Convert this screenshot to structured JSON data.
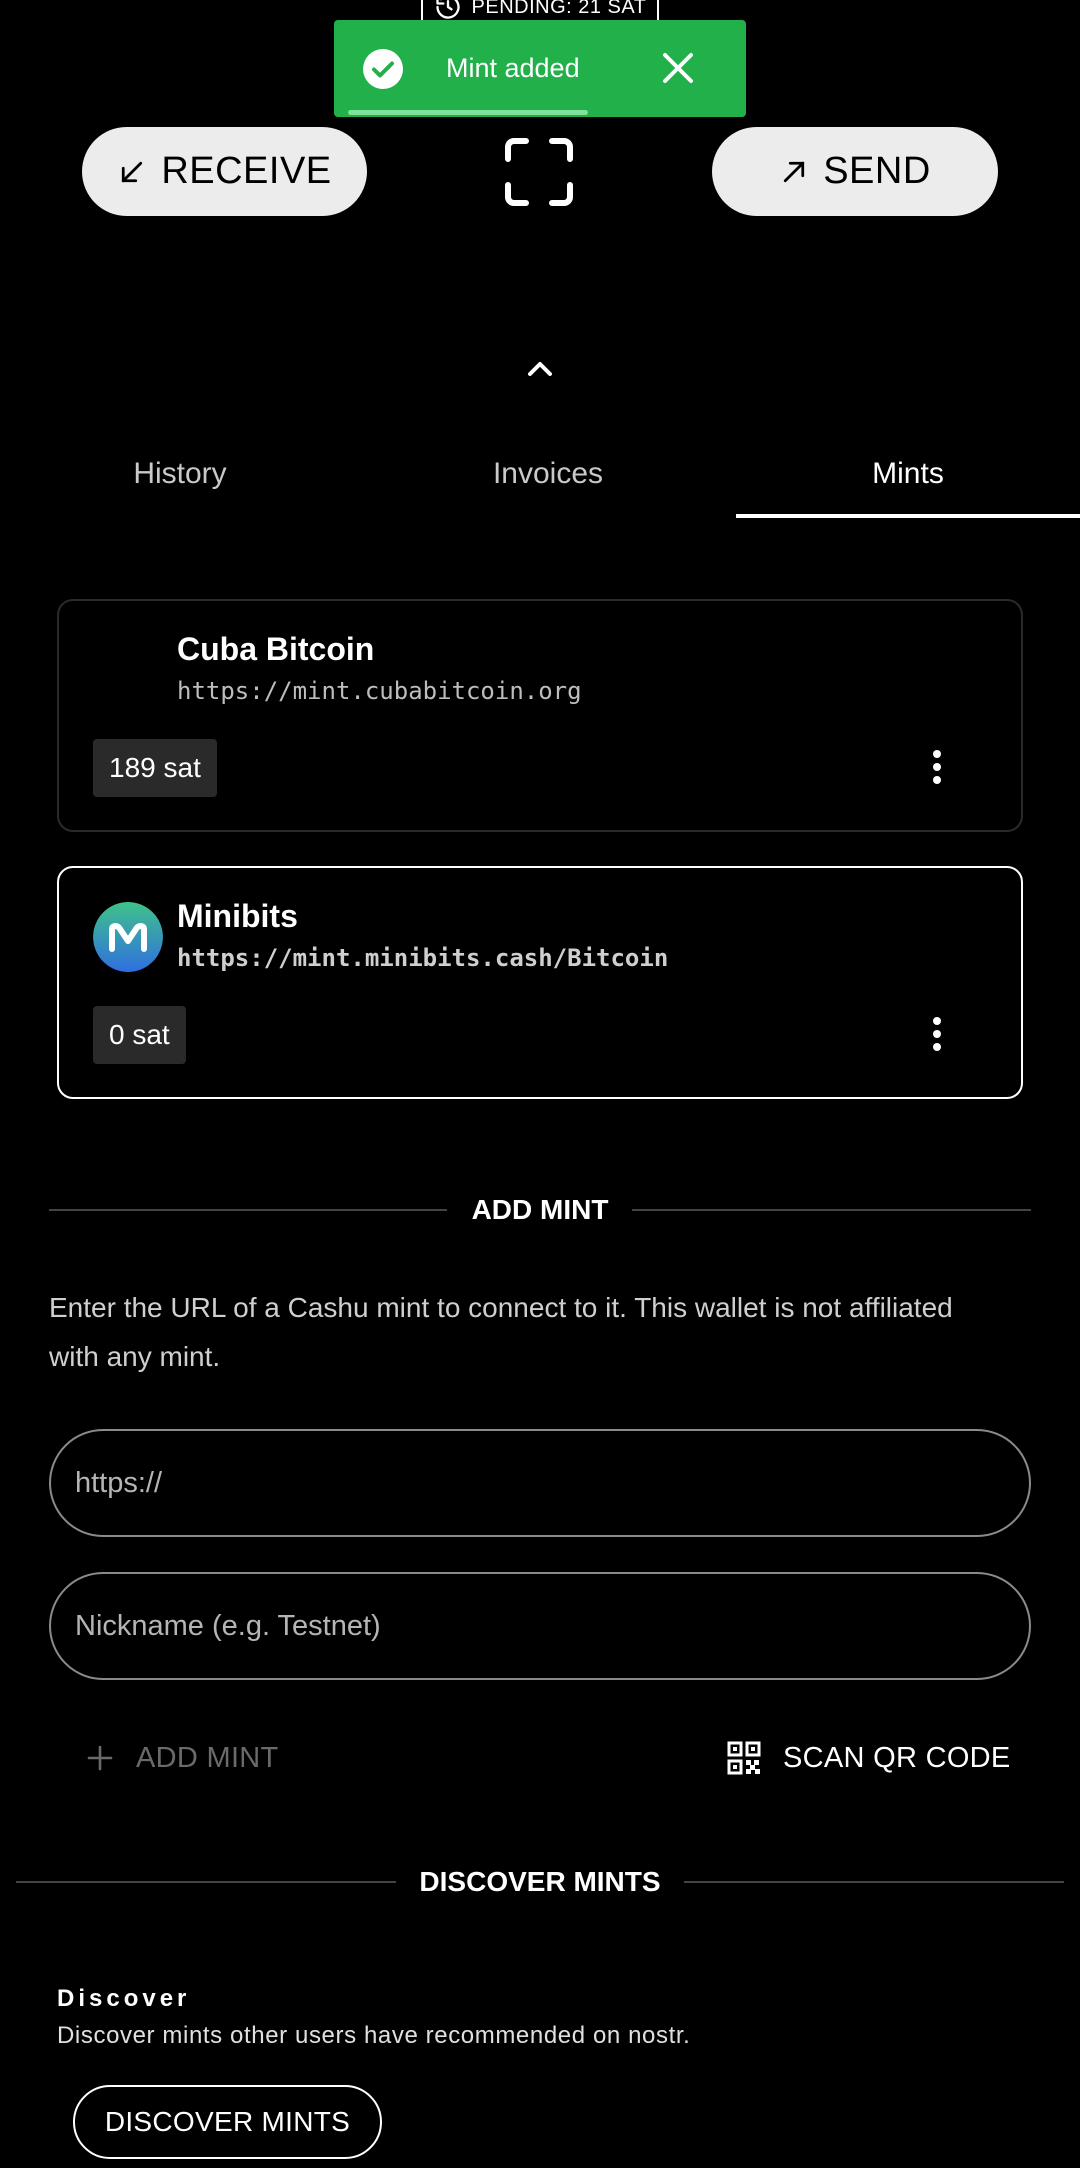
{
  "pending": {
    "label": "PENDING: 21 SAT",
    "icon": "history-icon"
  },
  "toast": {
    "message": "Mint added",
    "color": "#22b04a"
  },
  "actions": {
    "receive": "RECEIVE",
    "send": "SEND"
  },
  "tabs": [
    {
      "label": "History"
    },
    {
      "label": "Invoices"
    },
    {
      "label": "Mints",
      "active": true
    }
  ],
  "mints": [
    {
      "name": "Cuba Bitcoin",
      "url": "https://mint.cubabitcoin.org",
      "balance": "189 sat",
      "selected": false
    },
    {
      "name": "Minibits",
      "url": "https://mint.minibits.cash/Bitcoin",
      "balance": "0 sat",
      "selected": true,
      "avatar_letter": "M"
    }
  ],
  "add_mint": {
    "heading": "ADD MINT",
    "description": "Enter the URL of a Cashu mint to connect to it. This wallet is not affiliated with any mint.",
    "url_placeholder": "https://",
    "nickname_placeholder": "Nickname (e.g. Testnet)",
    "add_label": "ADD MINT",
    "scan_label": "SCAN QR CODE"
  },
  "discover": {
    "heading": "DISCOVER MINTS",
    "title": "Discover",
    "subtitle": "Discover mints other users have recommended on nostr.",
    "button": "DISCOVER MINTS"
  }
}
